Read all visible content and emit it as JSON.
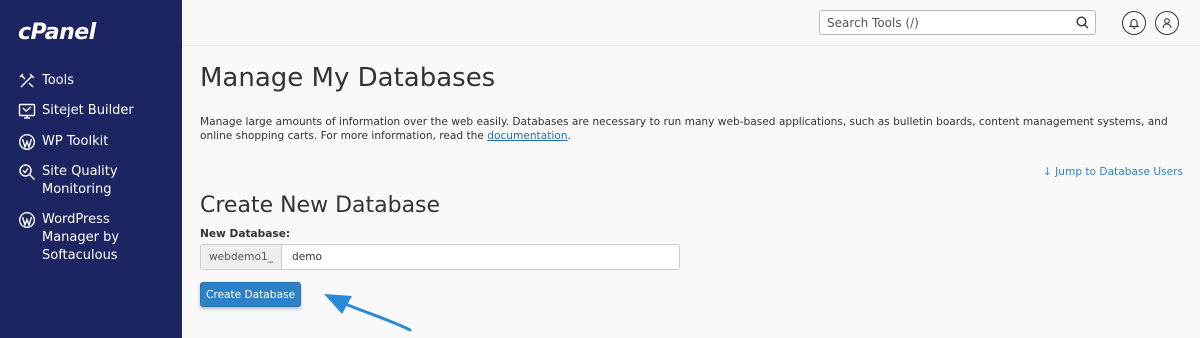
{
  "sidebar": {
    "logo": "cPanel",
    "items": [
      {
        "label": "Tools",
        "icon": "tools-icon"
      },
      {
        "label": "Sitejet Builder",
        "icon": "sitejet-icon"
      },
      {
        "label": "WP Toolkit",
        "icon": "wordpress-icon"
      },
      {
        "label": "Site Quality\nMonitoring",
        "icon": "site-quality-icon"
      },
      {
        "label": "WordPress\nManager by\nSoftaculous",
        "icon": "wordpress-icon"
      }
    ]
  },
  "header": {
    "search_placeholder": "Search Tools (/)",
    "notification_icon": "bell-icon",
    "user_icon": "user-icon"
  },
  "main": {
    "title": "Manage My Databases",
    "description_before_link": "Manage large amounts of information over the web easily. Databases are necessary to run many web-based applications, such as bulletin boards, content management systems, and online shopping carts. For more information, read the ",
    "description_link": "documentation",
    "description_after_link": ".",
    "jump_link": "Jump to Database Users",
    "create_section": {
      "title": "Create New Database",
      "field_label": "New Database:",
      "prefix": "webdemo1_",
      "value": "demo",
      "button_label": "Create Database"
    }
  },
  "colors": {
    "sidebar_bg": "#1c2562",
    "accent": "#2d82c7",
    "annotation_arrow": "#2b8ad8"
  }
}
